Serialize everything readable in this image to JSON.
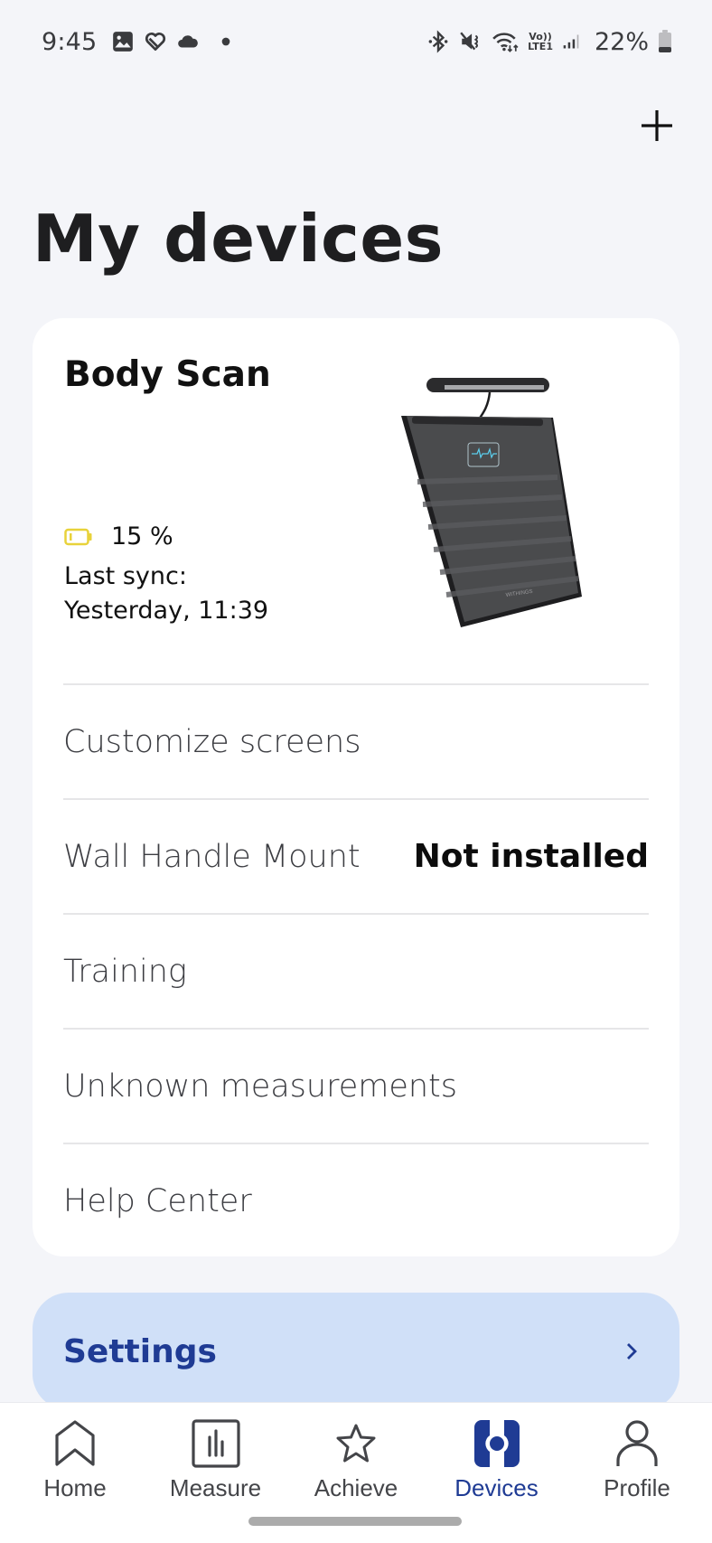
{
  "status_bar": {
    "time": "9:45",
    "left_icons": [
      "gallery-icon",
      "health-icon",
      "cloud-icon",
      "dot-icon"
    ],
    "right_icons": [
      "bluetooth-icon",
      "mute-icon",
      "wifi-icon",
      "volte-icon",
      "signal-icon"
    ],
    "volte_top": "Vo))",
    "volte_bottom": "LTE1",
    "battery_percent": "22%"
  },
  "header": {
    "add_icon": "plus-icon",
    "title": "My devices"
  },
  "device": {
    "name": "Body Scan",
    "battery_level": "15 %",
    "battery_color": "#e8d23a",
    "last_sync_label": "Last sync:",
    "last_sync_value": "Yesterday, 11:39",
    "image_alt": "Body Scan scale with handle",
    "menu": [
      {
        "label": "Customize screens",
        "value": ""
      },
      {
        "label": "Wall Handle Mount",
        "value": "Not installed"
      },
      {
        "label": "Training",
        "value": ""
      },
      {
        "label": "Unknown measurements",
        "value": ""
      },
      {
        "label": "Help Center",
        "value": ""
      }
    ]
  },
  "settings": {
    "label": "Settings",
    "accent": "#1f3b94",
    "background": "#d0e0f8"
  },
  "bottom_nav": {
    "items": [
      {
        "label": "Home",
        "icon": "home-icon",
        "active": false
      },
      {
        "label": "Measure",
        "icon": "measure-icon",
        "active": false
      },
      {
        "label": "Achieve",
        "icon": "star-icon",
        "active": false
      },
      {
        "label": "Devices",
        "icon": "devices-icon",
        "active": true
      },
      {
        "label": "Profile",
        "icon": "profile-icon",
        "active": false
      }
    ]
  }
}
